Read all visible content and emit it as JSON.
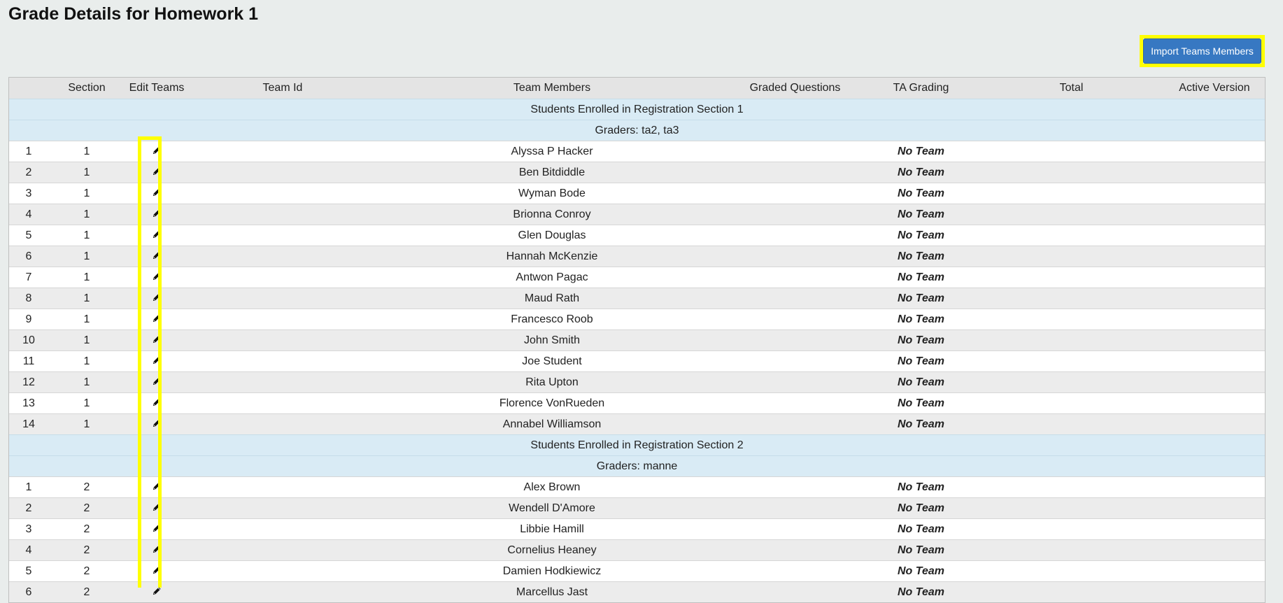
{
  "page": {
    "title": "Grade Details for Homework 1"
  },
  "toolbar": {
    "import_label": "Import Teams Members"
  },
  "table": {
    "headers": {
      "num": "",
      "section": "Section",
      "edit": "Edit Teams",
      "team_id": "Team Id",
      "members": "Team Members",
      "graded": "Graded Questions",
      "ta": "TA Grading",
      "total": "Total",
      "active": "Active Version"
    },
    "no_team": "No Team",
    "sections": [
      {
        "title": "Students Enrolled in Registration Section 1",
        "graders": "Graders: ta2, ta3",
        "rows": [
          {
            "n": "1",
            "section": "1",
            "name": "Alyssa P Hacker"
          },
          {
            "n": "2",
            "section": "1",
            "name": "Ben Bitdiddle"
          },
          {
            "n": "3",
            "section": "1",
            "name": "Wyman Bode"
          },
          {
            "n": "4",
            "section": "1",
            "name": "Brionna Conroy"
          },
          {
            "n": "5",
            "section": "1",
            "name": "Glen Douglas"
          },
          {
            "n": "6",
            "section": "1",
            "name": "Hannah McKenzie"
          },
          {
            "n": "7",
            "section": "1",
            "name": "Antwon Pagac"
          },
          {
            "n": "8",
            "section": "1",
            "name": "Maud Rath"
          },
          {
            "n": "9",
            "section": "1",
            "name": "Francesco Roob"
          },
          {
            "n": "10",
            "section": "1",
            "name": "John Smith"
          },
          {
            "n": "11",
            "section": "1",
            "name": "Joe Student"
          },
          {
            "n": "12",
            "section": "1",
            "name": "Rita Upton"
          },
          {
            "n": "13",
            "section": "1",
            "name": "Florence VonRueden"
          },
          {
            "n": "14",
            "section": "1",
            "name": "Annabel Williamson"
          }
        ]
      },
      {
        "title": "Students Enrolled in Registration Section 2",
        "graders": "Graders: manne",
        "rows": [
          {
            "n": "1",
            "section": "2",
            "name": "Alex Brown"
          },
          {
            "n": "2",
            "section": "2",
            "name": "Wendell D'Amore"
          },
          {
            "n": "3",
            "section": "2",
            "name": "Libbie Hamill"
          },
          {
            "n": "4",
            "section": "2",
            "name": "Cornelius Heaney"
          },
          {
            "n": "5",
            "section": "2",
            "name": "Damien Hodkiewicz"
          },
          {
            "n": "6",
            "section": "2",
            "name": "Marcellus Jast"
          }
        ]
      }
    ]
  },
  "colors": {
    "highlight": "#ffff00",
    "button": "#3778c2",
    "band": "#d9ebf5"
  }
}
